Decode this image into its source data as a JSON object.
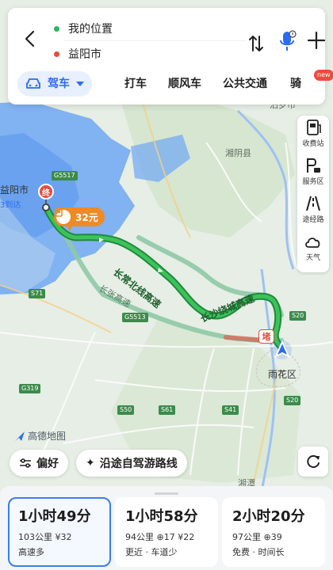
{
  "top": {
    "start": "我的位置",
    "end": "益阳市",
    "mode_tabs": [
      "驾车",
      "打车",
      "顺风车",
      "公共交通",
      "骑"
    ],
    "new_badge": "new"
  },
  "right_tools": [
    {
      "label": "收费站",
      "icon": "toll-station-icon"
    },
    {
      "label": "服务区",
      "icon": "service-area-icon"
    },
    {
      "label": "途经路",
      "icon": "via-road-icon"
    },
    {
      "label": "天气",
      "icon": "weather-icon"
    }
  ],
  "map": {
    "labels": {
      "yiyang": "益阳市",
      "arrive": "3到达",
      "xiangyin": "湘阴县",
      "miluo": "汨罗市",
      "yuhua": "雨花区",
      "xiangtan": "湘潭",
      "endpoint": "终",
      "toll": "32元",
      "jam": "堵"
    },
    "road_labels": {
      "changchang": "长常北线高速",
      "raocheng": "长沙绕城高速",
      "changzhang": "长张高速"
    },
    "route_badges": [
      "G5517",
      "S71",
      "G5513",
      "S20",
      "S50",
      "S41",
      "S61",
      "G319",
      "S20"
    ],
    "logo": "高德地图"
  },
  "buttons": {
    "preference": "偏好",
    "scenic": "沿途自驾游路线"
  },
  "routes": [
    {
      "time": "1小时49分",
      "meta": "103公里 ¥32",
      "tag": "高速多",
      "selected": true
    },
    {
      "time": "1小时58分",
      "meta": "94公里 ⊕17 ¥22",
      "tag": "更近 · 车道少",
      "selected": false
    },
    {
      "time": "2小时20分",
      "meta": "97公里 ⊕39",
      "tag": "免费 · 时间长",
      "selected": false
    }
  ],
  "colors": {
    "accent": "#2b6cf0",
    "route_active": "#2fa84a",
    "route_alt": "#8fc9a6",
    "water": "#6aa2f2",
    "jam": "#e84a3d"
  }
}
